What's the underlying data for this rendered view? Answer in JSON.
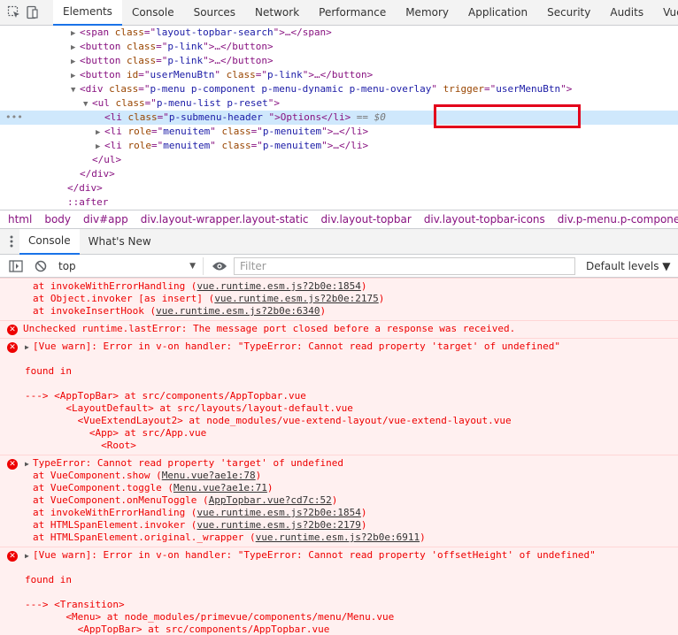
{
  "devtools_tabs": [
    "Elements",
    "Console",
    "Sources",
    "Network",
    "Performance",
    "Memory",
    "Application",
    "Security",
    "Audits",
    "Vue"
  ],
  "active_tab": "Elements",
  "icons": {
    "inspect": "cursor-select-icon",
    "device": "device-toggle-icon"
  },
  "elements_tree": [
    {
      "indent": 5,
      "expand": "right",
      "open": "<span ",
      "attrs": [
        [
          "class",
          "layout-topbar-search"
        ]
      ],
      "close": ">…</span>"
    },
    {
      "indent": 5,
      "expand": "right",
      "open": "<button ",
      "attrs": [
        [
          "class",
          "p-link"
        ]
      ],
      "close": ">…</button>"
    },
    {
      "indent": 5,
      "expand": "right",
      "open": "<button ",
      "attrs": [
        [
          "class",
          "p-link"
        ]
      ],
      "close": ">…</button>"
    },
    {
      "indent": 5,
      "expand": "right",
      "open": "<button ",
      "attrs": [
        [
          "id",
          "userMenuBtn"
        ],
        [
          "class",
          "p-link"
        ]
      ],
      "close": ">…</button>"
    },
    {
      "indent": 5,
      "expand": "down",
      "open": "<div ",
      "attrs": [
        [
          "class",
          "p-menu p-component p-menu-dynamic p-menu-overlay"
        ],
        [
          "trigger",
          "userMenuBtn"
        ]
      ],
      "close": ">"
    },
    {
      "indent": 6,
      "expand": "down",
      "open": "<ul ",
      "attrs": [
        [
          "class",
          "p-menu-list p-reset"
        ]
      ],
      "close": ">"
    },
    {
      "indent": 7,
      "expand": "",
      "open": "<li ",
      "attrs": [
        [
          "class",
          "p-submenu-header "
        ]
      ],
      "close": ">Options</li>",
      "selected": true,
      "hint": " == $0"
    },
    {
      "indent": 7,
      "expand": "right",
      "open": "<li ",
      "attrs": [
        [
          "role",
          "menuitem"
        ],
        [
          "class",
          "p-menuitem"
        ]
      ],
      "close": ">…</li>"
    },
    {
      "indent": 7,
      "expand": "right",
      "open": "<li ",
      "attrs": [
        [
          "role",
          "menuitem"
        ],
        [
          "class",
          "p-menuitem"
        ]
      ],
      "close": ">…</li>"
    },
    {
      "indent": 6,
      "expand": "",
      "open": "</ul>",
      "attrs": [],
      "close": ""
    },
    {
      "indent": 5,
      "expand": "",
      "open": "</div>",
      "attrs": [],
      "close": ""
    },
    {
      "indent": 4,
      "expand": "",
      "open": "</div>",
      "attrs": [],
      "close": ""
    },
    {
      "indent": 4,
      "expand": "",
      "open": "::after",
      "attrs": [],
      "close": "",
      "pseudo": true
    }
  ],
  "selected_dots": "•••",
  "breadcrumbs": [
    "html",
    "body",
    "div#app",
    "div.layout-wrapper.layout-static",
    "div.layout-topbar",
    "div.layout-topbar-icons",
    "div.p-menu.p-component.p-menu-dynamic.p-menu-overlay"
  ],
  "drawer_tabs": [
    "Console",
    "What's New"
  ],
  "drawer_active": "Console",
  "console_toolbar": {
    "context": "top",
    "filter_placeholder": "Filter",
    "levels": "Default levels ▼"
  },
  "console_messages": [
    {
      "error_icon": false,
      "lines": [
        {
          "text": "at invokeWithErrorHandling (",
          "link": "vue.runtime.esm.js?2b0e:1854",
          "tail": ")"
        },
        {
          "text": "at Object.invoker [as insert] (",
          "link": "vue.runtime.esm.js?2b0e:2175",
          "tail": ")"
        },
        {
          "text": "at invokeInsertHook (",
          "link": "vue.runtime.esm.js?2b0e:6340",
          "tail": ")"
        }
      ]
    },
    {
      "error_icon": true,
      "lines": [
        {
          "header": true,
          "noexp": true,
          "text": "Unchecked runtime.lastError: The message port closed before a response was received."
        }
      ]
    },
    {
      "error_icon": true,
      "lines": [
        {
          "header": true,
          "text": "[Vue warn]: Error in v-on handler: \"TypeError: Cannot read property 'target' of undefined\""
        },
        {
          "blank": true
        },
        {
          "raw": "found in"
        },
        {
          "blank": true
        },
        {
          "raw": "---> <AppTopBar> at src/components/AppTopbar.vue"
        },
        {
          "raw": "       <LayoutDefault> at src/layouts/layout-default.vue"
        },
        {
          "raw": "         <VueExtendLayout2> at node_modules/vue-extend-layout/vue-extend-layout.vue"
        },
        {
          "raw": "           <App> at src/App.vue"
        },
        {
          "raw": "             <Root>"
        }
      ]
    },
    {
      "error_icon": true,
      "lines": [
        {
          "header": true,
          "text": "TypeError: Cannot read property 'target' of undefined"
        },
        {
          "text": "at VueComponent.show (",
          "link": "Menu.vue?ae1e:78",
          "tail": ")"
        },
        {
          "text": "at VueComponent.toggle (",
          "link": "Menu.vue?ae1e:71",
          "tail": ")"
        },
        {
          "text": "at VueComponent.onMenuToggle (",
          "link": "AppTopbar.vue?cd7c:52",
          "tail": ")"
        },
        {
          "text": "at invokeWithErrorHandling (",
          "link": "vue.runtime.esm.js?2b0e:1854",
          "tail": ")"
        },
        {
          "text": "at HTMLSpanElement.invoker (",
          "link": "vue.runtime.esm.js?2b0e:2179",
          "tail": ")"
        },
        {
          "text": "at HTMLSpanElement.original._wrapper (",
          "link": "vue.runtime.esm.js?2b0e:6911",
          "tail": ")"
        }
      ]
    },
    {
      "error_icon": true,
      "lines": [
        {
          "header": true,
          "text": "[Vue warn]: Error in v-on handler: \"TypeError: Cannot read property 'offsetHeight' of undefined\""
        },
        {
          "blank": true
        },
        {
          "raw": "found in"
        },
        {
          "blank": true
        },
        {
          "raw": "---> <Transition>"
        },
        {
          "raw": "       <Menu> at node_modules/primevue/components/menu/Menu.vue"
        },
        {
          "raw": "         <AppTopBar> at src/components/AppTopbar.vue"
        }
      ]
    }
  ],
  "colors": {
    "highlight_border": "#e3001b",
    "selected_row": "#cfe8fc",
    "error_bg": "#fff0f0",
    "error_text": "#e00",
    "tab_underline": "#1a73e8"
  }
}
